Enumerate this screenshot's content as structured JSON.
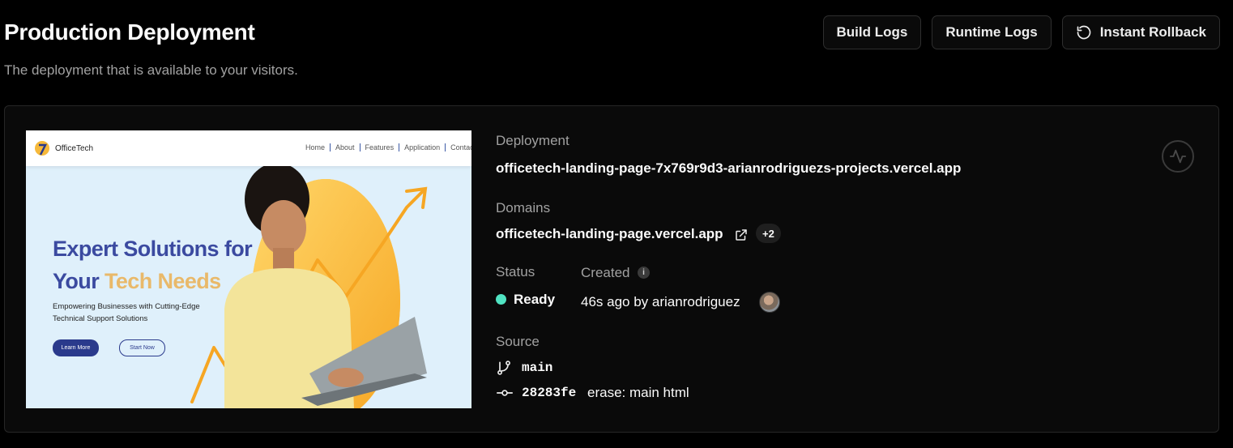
{
  "header": {
    "title": "Production Deployment",
    "subtitle": "The deployment that is available to your visitors."
  },
  "actions": {
    "build_logs": "Build Logs",
    "runtime_logs": "Runtime Logs",
    "instant_rollback": "Instant Rollback"
  },
  "preview": {
    "brand": "OfficeTech",
    "nav": [
      "Home",
      "About",
      "Features",
      "Application",
      "Contact"
    ],
    "headline_line1": "Expert Solutions for",
    "headline_line2_a": "Your ",
    "headline_line2_b": "Tech Needs",
    "paragraph": "Empowering Businesses with Cutting-Edge Technical Support Solutions",
    "primary_cta": "Learn More",
    "secondary_cta": "Start Now"
  },
  "deployment": {
    "label": "Deployment",
    "url": "officetech-landing-page-7x769r9d3-arianrodriguezs-projects.vercel.app"
  },
  "domains": {
    "label": "Domains",
    "primary": "officetech-landing-page.vercel.app",
    "extra_count": "+2"
  },
  "status": {
    "label": "Status",
    "value": "Ready",
    "color": "#50e3c2"
  },
  "created": {
    "label": "Created",
    "value": "46s ago by arianrodriguez"
  },
  "source": {
    "label": "Source",
    "branch": "main",
    "commit_sha": "28283fe",
    "commit_message": "erase: main html"
  },
  "icons": {
    "rollback": "rollback-icon",
    "external": "external-link-icon",
    "branch": "git-branch-icon",
    "commit": "git-commit-icon",
    "activity": "activity-icon",
    "info": "info-icon"
  }
}
